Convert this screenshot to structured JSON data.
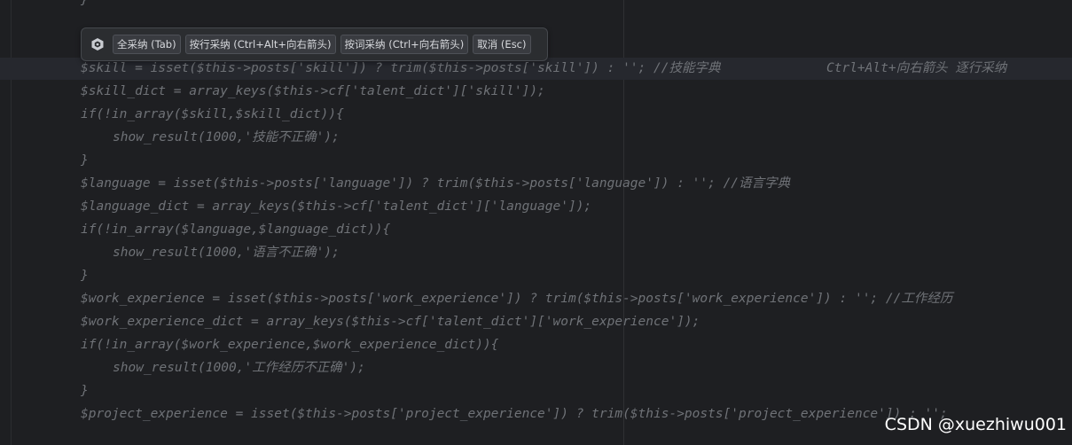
{
  "editor": {
    "top_partial": "}",
    "lines": [
      "$skill = isset($this->posts['skill']) ? trim($this->posts['skill']) : ''; //技能字典",
      "$skill_dict = array_keys($this->cf['talent_dict']['skill']);",
      "if(!in_array($skill,$skill_dict)){",
      "show_result(1000,'技能不正确');",
      "}",
      "$language = isset($this->posts['language']) ? trim($this->posts['language']) : ''; //语言字典",
      "$language_dict = array_keys($this->cf['talent_dict']['language']);",
      "if(!in_array($language,$language_dict)){",
      "show_result(1000,'语言不正确');",
      "}",
      "$work_experience = isset($this->posts['work_experience']) ? trim($this->posts['work_experience']) : ''; //工作经历",
      "$work_experience_dict = array_keys($this->cf['talent_dict']['work_experience']);",
      "if(!in_array($work_experience,$work_experience_dict)){",
      "show_result(1000,'工作经历不正确');",
      "}",
      "$project_experience = isset($this->posts['project_experience']) ? trim($this->posts['project_experience']) : '';"
    ],
    "inline_hint": "Ctrl+Alt+向右箭头 逐行采纳"
  },
  "completion_popup": {
    "logo_icon": "ai-assistant-logo-icon",
    "buttons": {
      "accept_all": "全采纳 (Tab)",
      "accept_line": "按行采纳 (Ctrl+Alt+向右箭头)",
      "accept_word": "按词采纳 (Ctrl+向右箭头)",
      "cancel": "取消 (Esc)"
    }
  },
  "watermark": "CSDN @xuezhiwu001",
  "colors": {
    "background": "#1e1f22",
    "code_text": "#8b8e94",
    "popup_bg": "#2b2d30",
    "button_bg": "#393b40"
  }
}
